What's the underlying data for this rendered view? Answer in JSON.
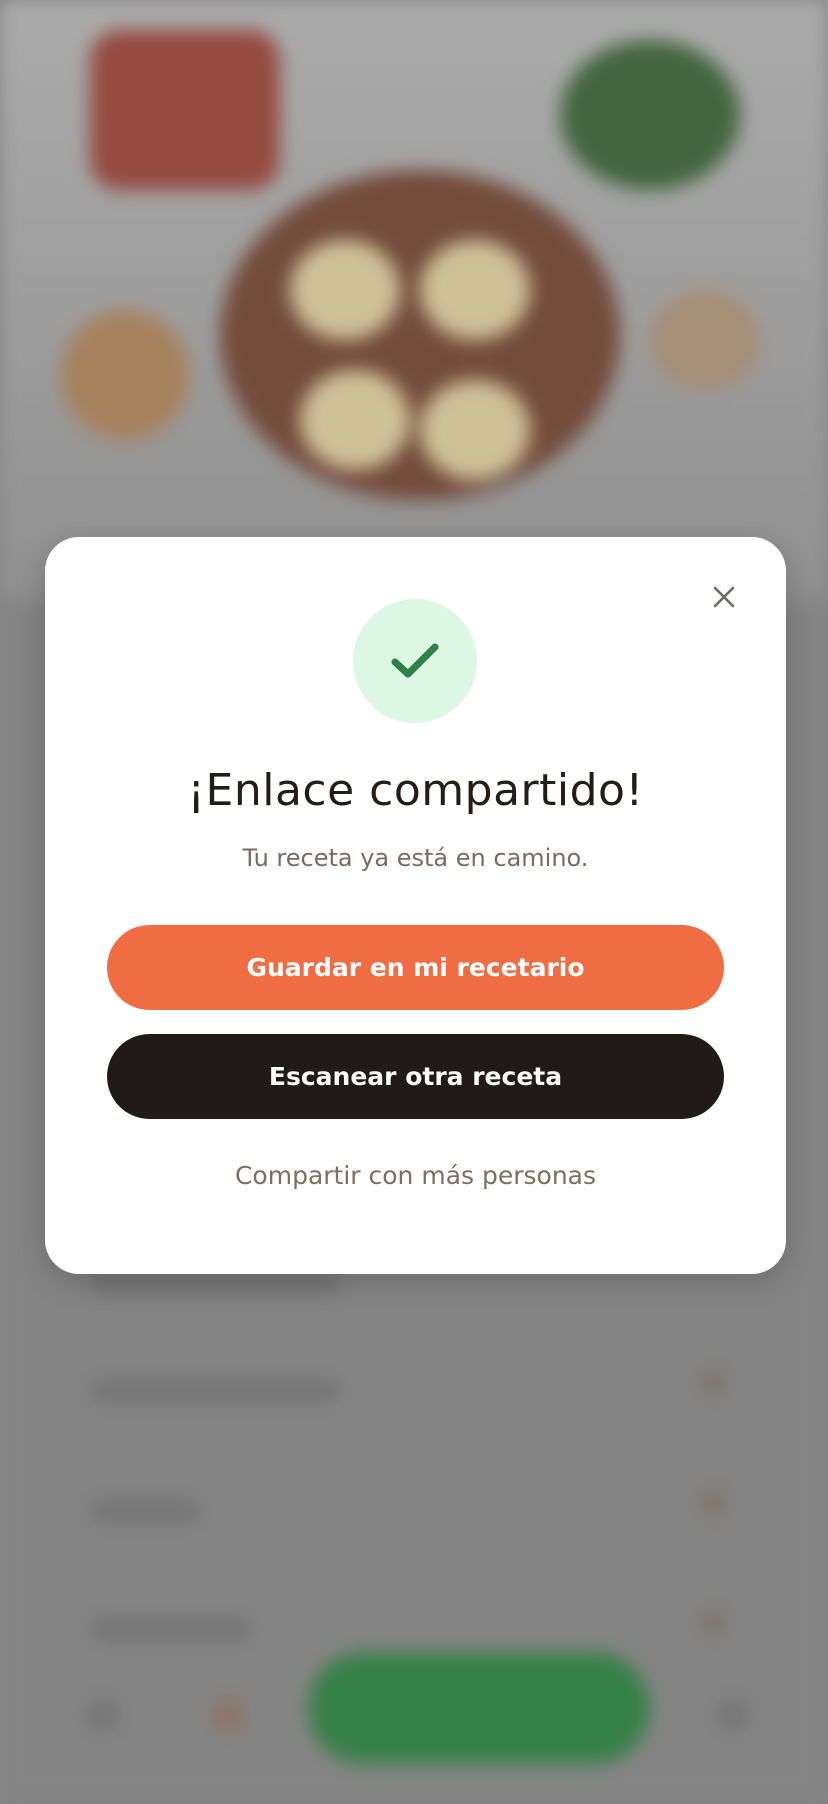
{
  "modal": {
    "title": "¡Enlace compartido!",
    "subtitle": "Tu receta ya está en camino.",
    "primary_button": "Guardar en mi recetario",
    "secondary_button": "Escanear otra receta",
    "share_link": "Compartir con más personas",
    "close_icon": "close-icon",
    "success_icon": "checkmark-icon"
  },
  "colors": {
    "accent_orange": "#f06c42",
    "dark_button": "#201b18",
    "success_green": "#2e8049",
    "success_bg": "#dcf7e4",
    "muted_text": "#7b6b5f"
  }
}
